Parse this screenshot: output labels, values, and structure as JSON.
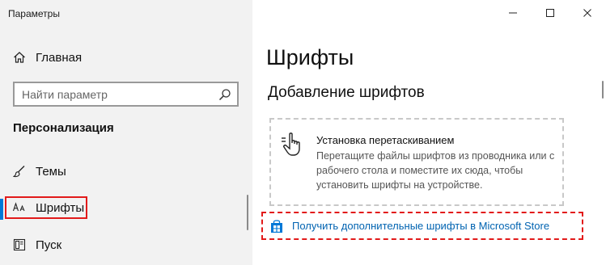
{
  "window": {
    "title": "Параметры",
    "controls": [
      "minimize",
      "maximize",
      "close"
    ]
  },
  "sidebar": {
    "home_label": "Главная",
    "search_placeholder": "Найти параметр",
    "section_header": "Персонализация",
    "items": [
      {
        "label": "Темы",
        "icon": "brush-icon"
      },
      {
        "label": "Шрифты",
        "icon": "fonts-icon",
        "selected": true
      },
      {
        "label": "Пуск",
        "icon": "start-icon"
      }
    ]
  },
  "main": {
    "page_title": "Шрифты",
    "section_title": "Добавление шрифтов",
    "drop_zone": {
      "title": "Установка перетаскиванием",
      "description": "Перетащите файлы шрифтов из проводника или с рабочего стола и поместите их сюда, чтобы установить шрифты на устройстве."
    },
    "store_link": "Получить дополнительные шрифты в Microsoft Store"
  },
  "colors": {
    "accent": "#0078d7",
    "link": "#0063b1",
    "highlight": "#e21a1a",
    "sidebar_bg": "#f2f2f2"
  }
}
